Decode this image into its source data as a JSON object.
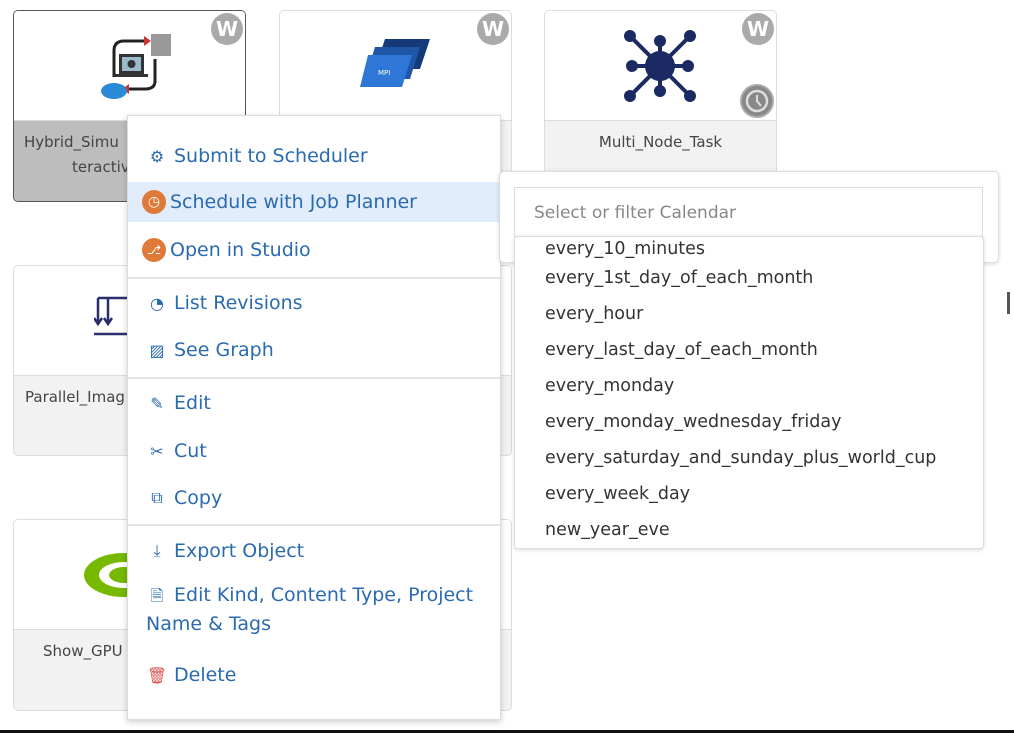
{
  "cards": [
    {
      "label": "Hybrid_Simu",
      "label2": "teractive",
      "badge": "W",
      "selected": true
    },
    {
      "label": "",
      "badge": "W",
      "icon_text": "MPI"
    },
    {
      "label": "Multi_Node_Task",
      "badge": "W",
      "scheduled": true
    },
    {
      "label": "Parallel_Imag"
    },
    {
      "label": "Show_GPU"
    }
  ],
  "menu": {
    "items": [
      {
        "label": "Submit to Scheduler",
        "icon": "gears-icon"
      },
      {
        "label": "Schedule with Job Planner",
        "icon": "clock-icon",
        "highlighted": true
      },
      {
        "label": "Open in Studio",
        "icon": "studio-icon"
      },
      {
        "label": "List Revisions",
        "icon": "history-icon"
      },
      {
        "label": "See Graph",
        "icon": "image-icon"
      },
      {
        "label": "Edit",
        "icon": "edit-icon"
      },
      {
        "label": "Cut",
        "icon": "scissors-icon"
      },
      {
        "label": "Copy",
        "icon": "copy-icon"
      },
      {
        "label": "Export Object",
        "icon": "download-icon"
      },
      {
        "label": "Edit Kind, Content Type, Project",
        "label2": "Name & Tags",
        "icon": "file-icon"
      },
      {
        "label": "Delete",
        "icon": "trash-icon"
      }
    ]
  },
  "calendar": {
    "placeholder": "Select or filter Calendar",
    "options": [
      "every_10_minutes",
      "every_1st_day_of_each_month",
      "every_hour",
      "every_last_day_of_each_month",
      "every_monday",
      "every_monday_wednesday_friday",
      "every_saturday_and_sunday_plus_world_cup",
      "every_week_day",
      "new_year_eve"
    ]
  },
  "colors": {
    "menu_text": "#2a6ab0",
    "highlight": "#e1edfb",
    "orange": "#e07a3a",
    "delete": "#d9534f"
  }
}
